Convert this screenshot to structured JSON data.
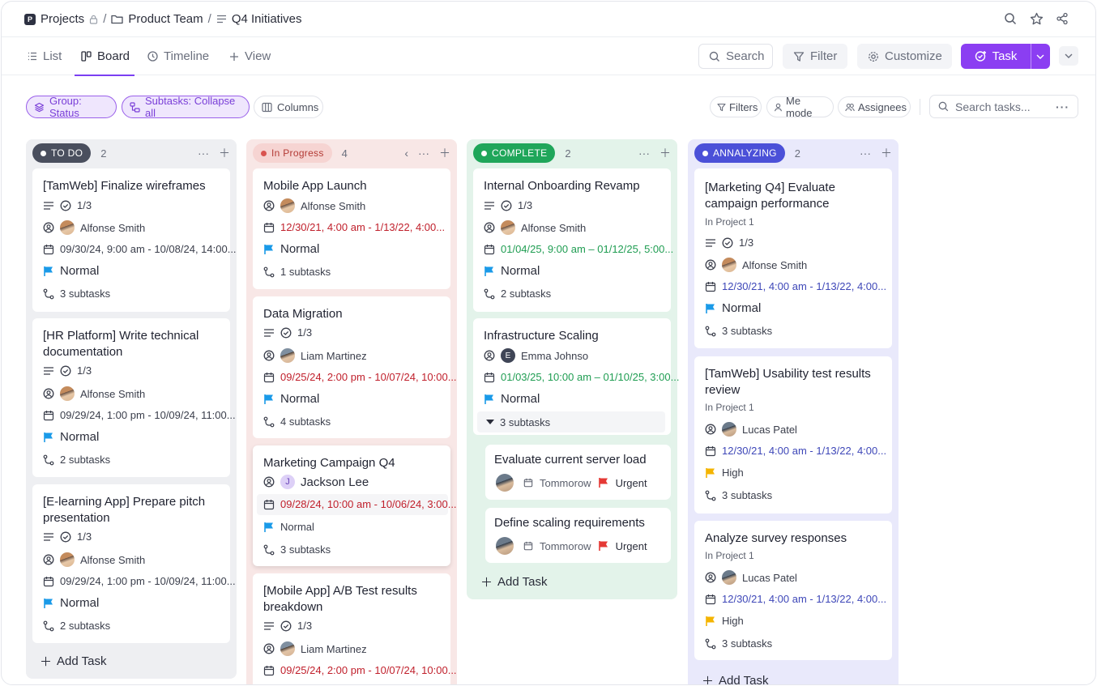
{
  "breadcrumb": {
    "badge": "P",
    "items": [
      "Projects",
      "Product Team",
      "Q4 Initiatives"
    ],
    "separator": "/"
  },
  "views": {
    "tabs": [
      {
        "label": "List",
        "icon": "list-icon"
      },
      {
        "label": "Board",
        "icon": "board-icon",
        "active": true
      },
      {
        "label": "Timeline",
        "icon": "clock-icon"
      },
      {
        "label": "View",
        "icon": "plus-icon"
      }
    ],
    "search": "Search",
    "filter": "Filter",
    "customize": "Customize",
    "task": "Task"
  },
  "filters": {
    "group": "Group: Status",
    "subtasks": "Subtasks: Collapse all",
    "columns": "Columns",
    "filters": "Filters",
    "me_mode": "Me mode",
    "assignees": "Assignees",
    "search_placeholder": "Search tasks..."
  },
  "colors": {
    "accent": "#8b3ef2",
    "todo": "#3f4556",
    "in_progress": "#d9534f",
    "complete": "#1fa65a",
    "analyzing": "#4b50d8",
    "flag_normal": "#1a9ae8",
    "flag_high": "#f4b400",
    "flag_urgent": "#e53935"
  },
  "add_task": "Add Task",
  "columns": [
    {
      "status": "TO DO",
      "count": "2",
      "cards": [
        {
          "title": "[TamWeb] Finalize wireframes",
          "checklist": "1/3",
          "assignee": "Alfonse Smith",
          "dates": "09/30/24, 9:00 am - 10/08/24, 14:00...",
          "priority": "Normal",
          "subtasks": "3 subtasks"
        },
        {
          "title": "[HR Platform] Write technical documentation",
          "checklist": "1/3",
          "assignee": "Alfonse Smith",
          "dates": "09/29/24, 1:00 pm - 10/09/24, 11:00...",
          "priority": "Normal",
          "subtasks": "2 subtasks"
        },
        {
          "title": "[E-learning App] Prepare pitch presentation",
          "checklist": "1/3",
          "assignee": "Alfonse Smith",
          "dates": "09/29/24, 1:00 pm - 10/09/24, 11:00...",
          "priority": "Normal",
          "subtasks": "2 subtasks"
        }
      ]
    },
    {
      "status": "In Progress",
      "count": "4",
      "cards": [
        {
          "title": "Mobile App Launch",
          "assignee": "Alfonse Smith",
          "dates": "12/30/21, 4:00 am - 1/13/22, 4:00...",
          "priority": "Normal",
          "subtasks": "1 subtasks"
        },
        {
          "title": "Data Migration",
          "checklist": "1/3",
          "assignee": "Liam Martinez",
          "dates": "09/25/24, 2:00 pm - 10/07/24, 10:00...",
          "priority": "Normal",
          "subtasks": "4 subtasks"
        },
        {
          "title": "Marketing Campaign Q4",
          "assignee": "Jackson Lee",
          "assignee_initial": "J",
          "dates": "09/28/24, 10:00 am - 10/06/24, 3:00...",
          "priority": "Normal",
          "subtasks": "3 subtasks"
        },
        {
          "title": "[Mobile App] A/B Test results breakdown",
          "checklist": "1/3",
          "assignee": "Liam Martinez",
          "dates": "09/25/24, 2:00 pm - 10/07/24, 10:00..."
        }
      ]
    },
    {
      "status": "COMPLETE",
      "count": "2",
      "cards": [
        {
          "title": "Internal Onboarding Revamp",
          "checklist": "1/3",
          "assignee": "Alfonse Smith",
          "dates": "01/04/25, 9:00 am – 01/12/25, 5:00...",
          "priority": "Normal",
          "subtasks": "2 subtasks"
        },
        {
          "title": "Infrastructure Scaling",
          "assignee": "Emma Johnso",
          "assignee_initial": "E",
          "dates": "01/03/25, 10:00 am – 01/10/25, 3:00...",
          "priority": "Normal",
          "subtasks": "3 subtasks",
          "children": [
            {
              "title": "Evaluate current server load",
              "due": "Tommorow",
              "priority": "Urgent"
            },
            {
              "title": "Define scaling requirements",
              "due": "Tommorow",
              "priority": "Urgent"
            }
          ]
        }
      ]
    },
    {
      "status": "ANNALYZING",
      "count": "2",
      "cards": [
        {
          "title": "[Marketing Q4] Evaluate campaign performance",
          "project": "In Project 1",
          "checklist": "1/3",
          "assignee": "Alfonse Smith",
          "dates": "12/30/21, 4:00 am - 1/13/22, 4:00...",
          "priority": "Normal",
          "subtasks": "3 subtasks"
        },
        {
          "title": "[TamWeb] Usability test results review",
          "project": "In Project 1",
          "assignee": "Lucas Patel",
          "dates": "12/30/21, 4:00 am - 1/13/22, 4:00...",
          "priority": "High",
          "subtasks": "3 subtasks"
        },
        {
          "title": "Analyze survey responses",
          "project": "In Project 1",
          "assignee": "Lucas Patel",
          "dates": "12/30/21, 4:00 am - 1/13/22, 4:00...",
          "priority": "High",
          "subtasks": "3 subtasks"
        }
      ]
    }
  ]
}
